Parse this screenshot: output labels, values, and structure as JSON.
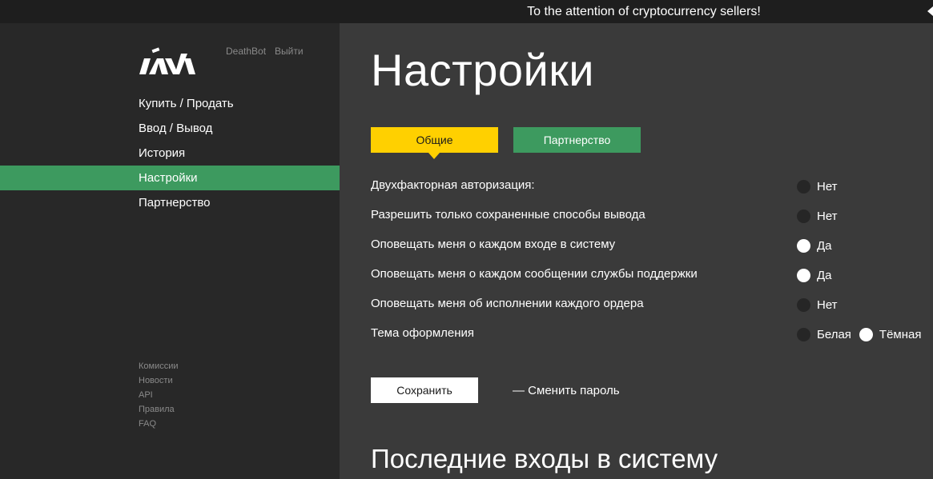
{
  "topbar": {
    "notice": "To the attention of cryptocurrency sellers!"
  },
  "sidebar": {
    "user": "DeathBot",
    "logout": "Выйти",
    "nav": [
      {
        "label": "Купить / Продать",
        "active": false
      },
      {
        "label": "Ввод / Вывод",
        "active": false
      },
      {
        "label": "История",
        "active": false
      },
      {
        "label": "Настройки",
        "active": true
      },
      {
        "label": "Партнерство",
        "active": false
      }
    ],
    "footer": [
      "Комиссии",
      "Новости",
      "API",
      "Правила",
      "FAQ"
    ]
  },
  "main": {
    "title": "Настройки",
    "tabs": [
      {
        "label": "Общие",
        "active": true
      },
      {
        "label": "Партнерство",
        "active": false
      }
    ],
    "settings": [
      {
        "label": "Двухфакторная авторизация:",
        "options": [
          {
            "label": "Нет",
            "selected": false
          }
        ]
      },
      {
        "label": "Разрешить только сохраненные способы вывода",
        "options": [
          {
            "label": "Нет",
            "selected": false
          }
        ]
      },
      {
        "label": "Оповещать меня о каждом входе в систему",
        "options": [
          {
            "label": "Да",
            "selected": true
          }
        ]
      },
      {
        "label": "Оповещать меня о каждом сообщении службы поддержки",
        "options": [
          {
            "label": "Да",
            "selected": true
          }
        ]
      },
      {
        "label": "Оповещать меня об исполнении каждого ордера",
        "options": [
          {
            "label": "Нет",
            "selected": false
          }
        ]
      },
      {
        "label": "Тема оформления",
        "options": [
          {
            "label": "Белая",
            "selected": false
          },
          {
            "label": "Тёмная",
            "selected": true
          }
        ]
      }
    ],
    "save_label": "Сохранить",
    "change_password": "— Сменить пароль",
    "recent_logins_title": "Последние входы в систему"
  },
  "colors": {
    "accent_yellow": "#ffd000",
    "accent_green": "#3d9a5f",
    "main_bg": "#3a3a3a",
    "sidebar_bg": "#282828"
  }
}
